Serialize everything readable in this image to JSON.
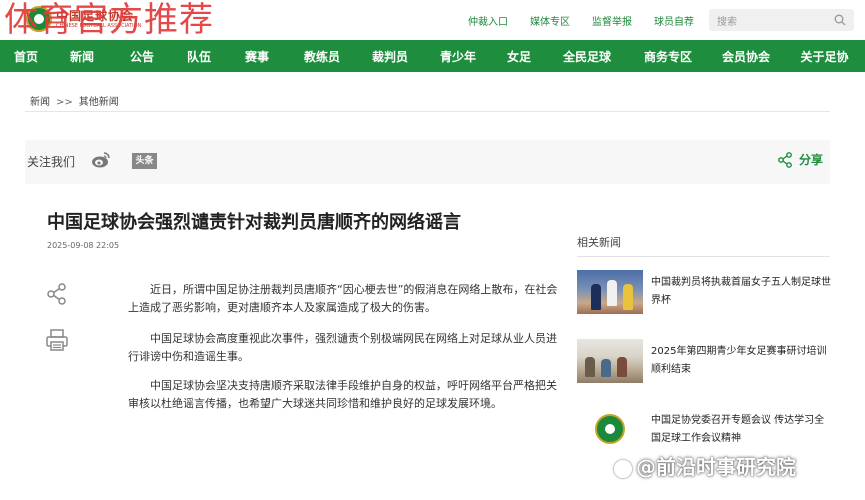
{
  "header": {
    "logo_cn": "中国足球协会",
    "logo_en": "CHINESE FOOTBALL ASSOCIATION",
    "watermark_overlay": "体育官方推荐",
    "top_links": [
      "仲裁入口",
      "媒体专区",
      "监督举报",
      "球员自荐"
    ],
    "search_placeholder": "搜索"
  },
  "nav": {
    "items": [
      "首页",
      "新闻",
      "公告",
      "队伍",
      "赛事",
      "教练员",
      "裁判员",
      "青少年",
      "女足",
      "全民足球",
      "商务专区",
      "会员协会",
      "关于足协"
    ]
  },
  "breadcrumb": {
    "home": "新闻",
    "separator": ">>",
    "current": "其他新闻"
  },
  "follow": {
    "label": "关注我们",
    "toutiao": "头条",
    "share_label": "分享"
  },
  "article": {
    "title": "中国足球协会强烈谴责针对裁判员唐顺齐的网络谣言",
    "date": "2025-09-08 22:05",
    "paragraphs": [
      "近日，所谓中国足协注册裁判员唐顺齐“因心梗去世”的假消息在网络上散布，在社会上造成了恶劣影响，更对唐顺齐本人及家属造成了极大的伤害。",
      "中国足球协会高度重视此次事件，强烈谴责个别极端网民在网络上对足球从业人员进行诽谤中伤和造谣生事。",
      "中国足球协会坚决支持唐顺齐采取法律手段维护自身的权益，呼吁网络平台严格把关审核以杜绝谣言传播，也希望广大球迷共同珍惜和维护良好的足球发展环境。"
    ]
  },
  "related": {
    "title": "相关新闻",
    "items": [
      {
        "text": "中国裁判员将执裁首届女子五人制足球世界杯"
      },
      {
        "text": "2025年第四期青少年女足赛事研讨培训顺利结束"
      },
      {
        "text": "中国足协党委召开专题会议 传达学习全国足球工作会议精神"
      }
    ]
  },
  "watermark_bottom": "@前沿时事研究院",
  "colors": {
    "brand_green": "#1e8e3e",
    "watermark_red": "#e23a3a",
    "logo_red": "#c0392b"
  }
}
